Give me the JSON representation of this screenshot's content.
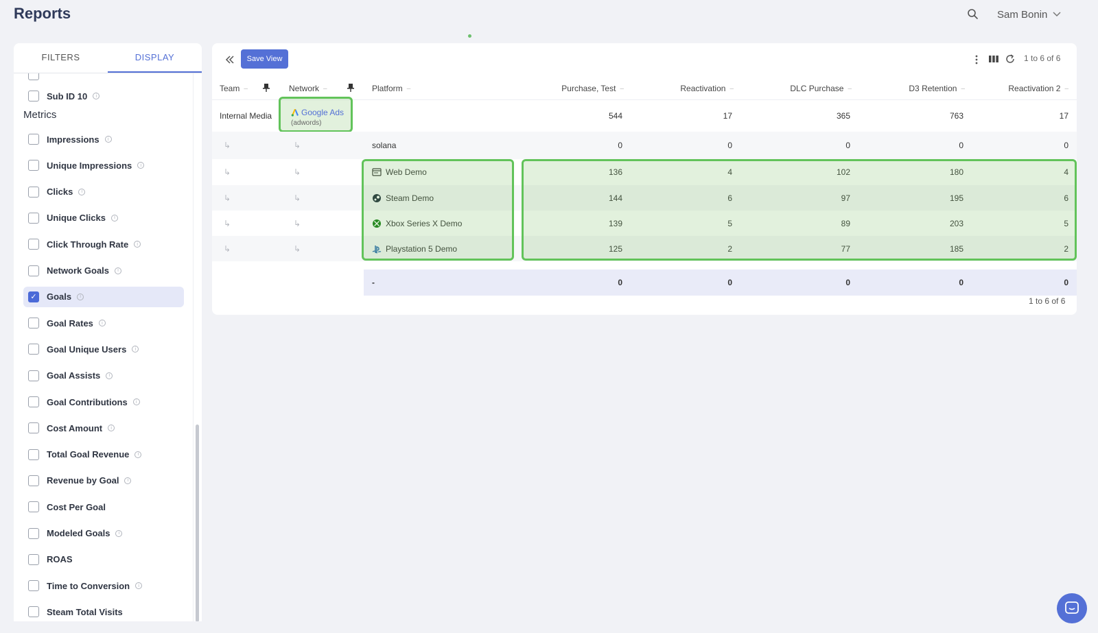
{
  "app": {
    "title": "Reports"
  },
  "user": {
    "name": "Sam Bonin"
  },
  "sidebar": {
    "tabs": [
      {
        "label": "FILTERS",
        "active": false
      },
      {
        "label": "DISPLAY",
        "active": true
      }
    ],
    "sub_item": {
      "label": "Sub ID 10",
      "checked": false
    },
    "section_title": "Metrics",
    "metrics": [
      {
        "label": "Impressions",
        "checked": false,
        "info": true
      },
      {
        "label": "Unique Impressions",
        "checked": false,
        "info": true
      },
      {
        "label": "Clicks",
        "checked": false,
        "info": true
      },
      {
        "label": "Unique Clicks",
        "checked": false,
        "info": true
      },
      {
        "label": "Click Through Rate",
        "checked": false,
        "info": true
      },
      {
        "label": "Network Goals",
        "checked": false,
        "info": true
      },
      {
        "label": "Goals",
        "checked": true,
        "info": true
      },
      {
        "label": "Goal Rates",
        "checked": false,
        "info": true
      },
      {
        "label": "Goal Unique Users",
        "checked": false,
        "info": true
      },
      {
        "label": "Goal Assists",
        "checked": false,
        "info": true
      },
      {
        "label": "Goal Contributions",
        "checked": false,
        "info": true
      },
      {
        "label": "Cost Amount",
        "checked": false,
        "info": true
      },
      {
        "label": "Total Goal Revenue",
        "checked": false,
        "info": true
      },
      {
        "label": "Revenue by Goal",
        "checked": false,
        "info": true
      },
      {
        "label": "Cost Per Goal",
        "checked": false,
        "info": false
      },
      {
        "label": "Modeled Goals",
        "checked": false,
        "info": true
      },
      {
        "label": "ROAS",
        "checked": false,
        "info": false
      },
      {
        "label": "Time to Conversion",
        "checked": false,
        "info": true
      },
      {
        "label": "Steam Total Visits",
        "checked": false,
        "info": false
      }
    ]
  },
  "toolbar": {
    "save_label": "Save View",
    "pager": "1 to 6 of 6"
  },
  "table": {
    "headers": {
      "team": "Team",
      "network": "Network",
      "platform": "Platform",
      "purchase_test": "Purchase, Test",
      "reactivation": "Reactivation",
      "dlc_purchase": "DLC Purchase",
      "d3_retention": "D3 Retention",
      "reactivation_2": "Reactivation 2"
    },
    "group_row": {
      "team": "Internal Media",
      "network": "Google Ads",
      "network_sub": "(adwords)",
      "values": [
        "544",
        "17",
        "365",
        "763",
        "17"
      ]
    },
    "rows": [
      {
        "platform": "solana",
        "icon": "",
        "values": [
          "0",
          "0",
          "0",
          "0",
          "0"
        ]
      },
      {
        "platform": "Web Demo",
        "icon": "browser-window-icon",
        "values": [
          "136",
          "4",
          "102",
          "180",
          "4"
        ]
      },
      {
        "platform": "Steam Demo",
        "icon": "steam-icon",
        "values": [
          "144",
          "6",
          "97",
          "195",
          "6"
        ]
      },
      {
        "platform": "Xbox Series X Demo",
        "icon": "xbox-icon",
        "values": [
          "139",
          "5",
          "89",
          "203",
          "5"
        ]
      },
      {
        "platform": "Playstation 5 Demo",
        "icon": "playstation-icon",
        "values": [
          "125",
          "2",
          "77",
          "185",
          "2"
        ]
      }
    ],
    "total_row": {
      "label": "-",
      "values": [
        "0",
        "0",
        "0",
        "0",
        "0"
      ]
    },
    "sub_arrow": "↳"
  },
  "pager_bottom": "1 to 6 of 6",
  "colors": {
    "accent": "#5470d6",
    "highlight": "#62c35a",
    "title": "#2f3a5a"
  }
}
